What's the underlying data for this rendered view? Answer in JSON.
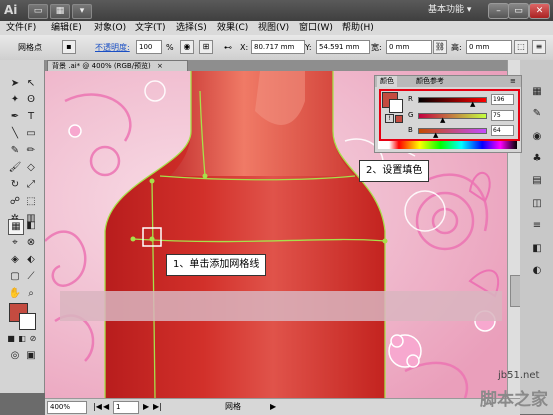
{
  "app": {
    "logo": "Ai",
    "workspace": "基本功能 ▾"
  },
  "menu": [
    "文件(F)",
    "编辑(E)",
    "对象(O)",
    "文字(T)",
    "选择(S)",
    "效果(C)",
    "视图(V)",
    "窗口(W)",
    "帮助(H)"
  ],
  "control": {
    "selection_label": "网格点",
    "opacity_label": "不透明度:",
    "opacity_value": "100",
    "opacity_unit": "%",
    "x_label": "X:",
    "x_value": "80.717 mm",
    "y_label": "Y:",
    "y_value": "54.591 mm",
    "w_label": "宽:",
    "w_value": "0 mm",
    "h_label": "高:",
    "h_value": "0 mm"
  },
  "document": {
    "tab_title": "背景 .ai* @ 400% (RGB/预览)",
    "close": "×"
  },
  "color_panel": {
    "tab_color": "颜色",
    "tab_guide": "颜色参考",
    "r_label": "R",
    "g_label": "G",
    "b_label": "B",
    "r_value": "196",
    "g_value": "75",
    "b_value": "64",
    "r": 196,
    "g": 75,
    "b": 64,
    "fill_color": "#c44b40"
  },
  "callouts": {
    "step1": "1、单击添加网格线",
    "step2": "2、设置填色"
  },
  "status": {
    "zoom": "400%",
    "page": "1",
    "label": "网格"
  },
  "watermark": {
    "site": "jb51.net",
    "name": "脚本之家"
  },
  "colors": {
    "highlight": "#e60012",
    "bottle": "#cc2b26",
    "mesh": "#a8e04a",
    "canvas": "#f4c7d6"
  }
}
